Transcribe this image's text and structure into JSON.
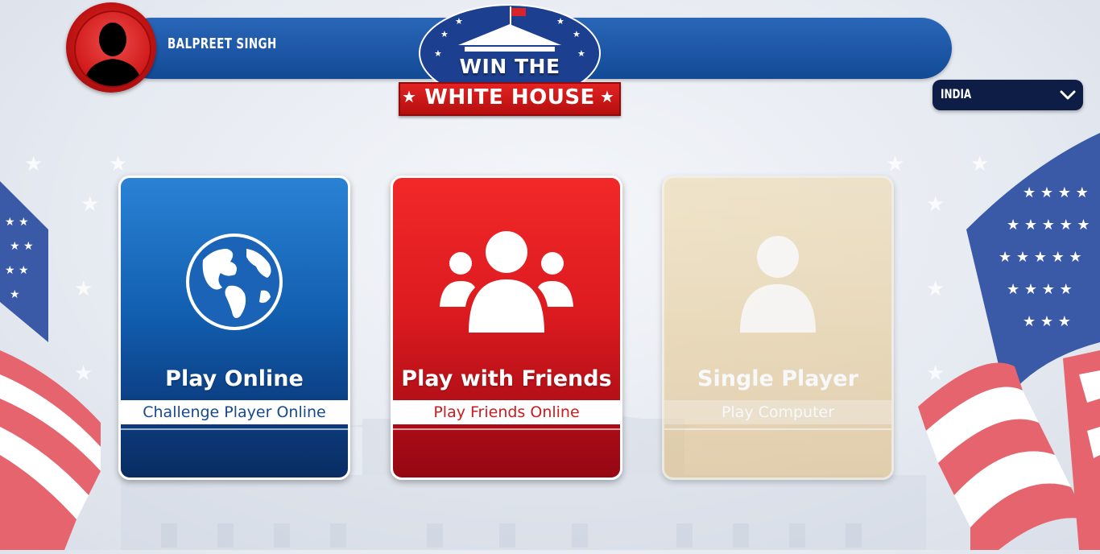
{
  "player": {
    "name": "BALPREET SINGH"
  },
  "logo": {
    "line1": "WIN THE",
    "line2": "WHITE HOUSE"
  },
  "country_select": {
    "value": "INDIA"
  },
  "modes": [
    {
      "title": "Play Online",
      "subtitle": "Challenge Player Online",
      "icon": "globe-icon",
      "enabled": true,
      "color": "#125fb0"
    },
    {
      "title": "Play with Friends",
      "subtitle": "Play Friends Online",
      "icon": "friends-group-icon",
      "enabled": true,
      "color": "#dc1b20"
    },
    {
      "title": "Single Player",
      "subtitle": "Play Computer",
      "icon": "person-icon",
      "enabled": false,
      "color": "#e8cf9e"
    }
  ],
  "colors": {
    "bar_blue": "#1a56a4",
    "accent_red": "#d11a1a",
    "dark_navy": "#0d1d45"
  }
}
